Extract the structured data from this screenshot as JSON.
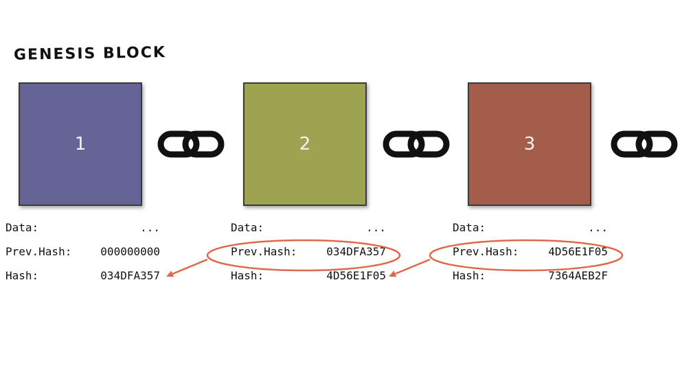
{
  "title": "GENESIS BLOCK",
  "colors": {
    "block_1": "#666497",
    "block_2": "#9da350",
    "block_3": "#a45d4a",
    "highlight": "#e0684a"
  },
  "blocks": [
    {
      "number": "1",
      "data_label": "Data:",
      "data_value": "...",
      "prev_label": "Prev.Hash:",
      "prev_value": "000000000",
      "hash_label": "Hash:",
      "hash_value": "034DFA357"
    },
    {
      "number": "2",
      "data_label": "Data:",
      "data_value": "...",
      "prev_label": "Prev.Hash:",
      "prev_value": "034DFA357",
      "hash_label": "Hash:",
      "hash_value": "4D56E1F05"
    },
    {
      "number": "3",
      "data_label": "Data:",
      "data_value": "...",
      "prev_label": "Prev.Hash:",
      "prev_value": "4D56E1F05",
      "hash_label": "Hash:",
      "hash_value": "7364AEB2F"
    }
  ],
  "icons": [
    "chain-link-icon",
    "chain-link-icon",
    "chain-link-icon"
  ]
}
